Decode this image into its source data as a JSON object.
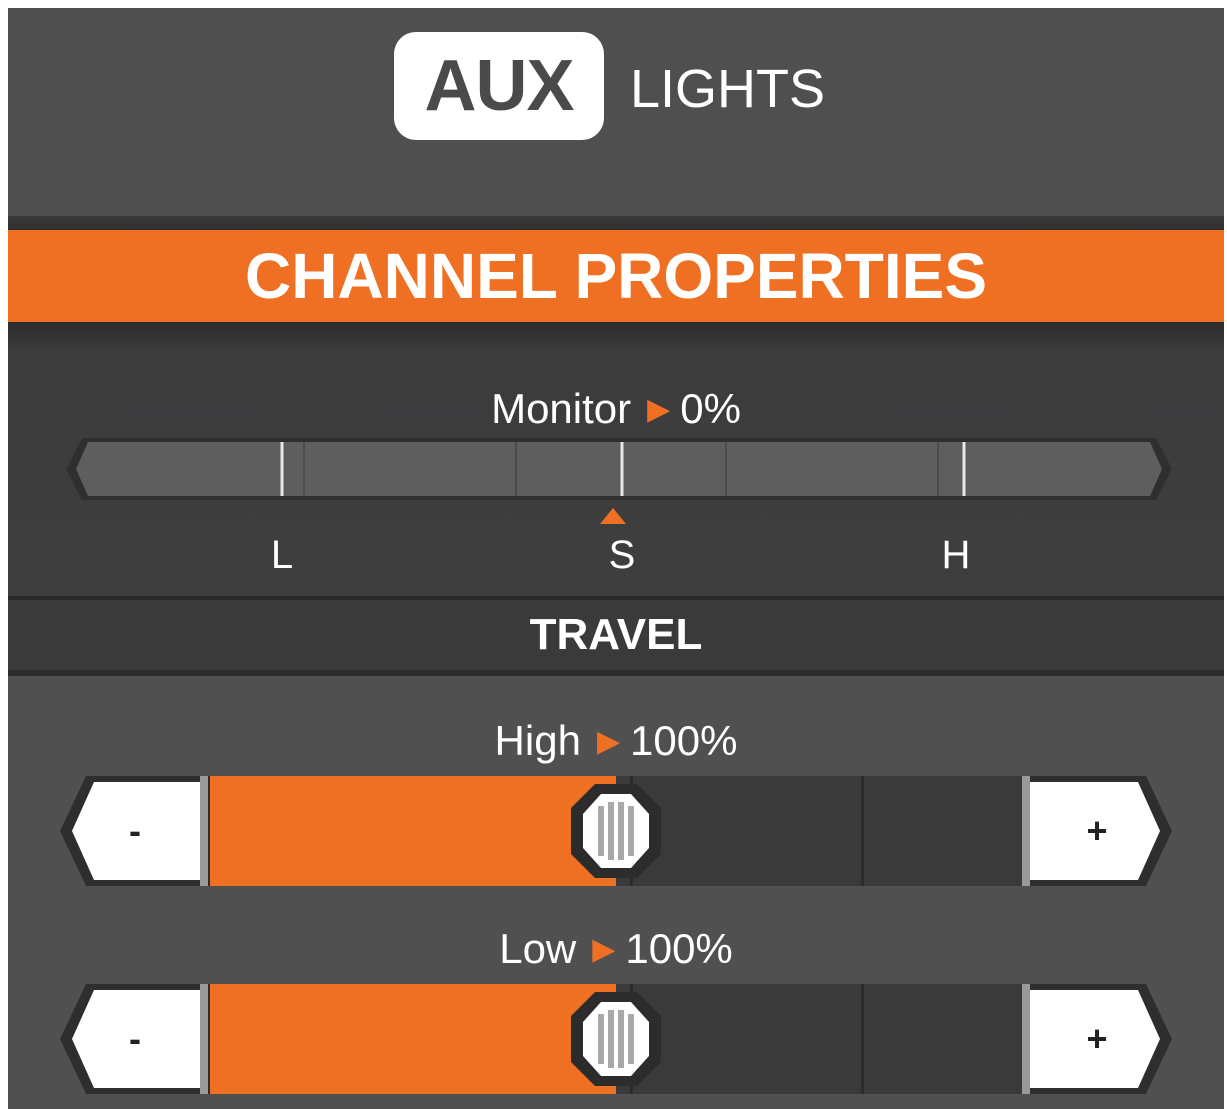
{
  "header": {
    "badge": "AUX",
    "title": "LIGHTS"
  },
  "banner": {
    "title": "CHANNEL PROPERTIES"
  },
  "monitor": {
    "label": "Monitor",
    "value_text": "0%",
    "value": 0,
    "tick_labels": {
      "low": "L",
      "center": "S",
      "high": "H"
    }
  },
  "travel": {
    "title": "TRAVEL",
    "high": {
      "label": "High",
      "value_text": "100%",
      "value": 100,
      "fill_fraction": 0.5,
      "minus": "-",
      "plus": "+"
    },
    "low": {
      "label": "Low",
      "value_text": "100%",
      "value": 100,
      "fill_fraction": 0.5,
      "minus": "-",
      "plus": "+"
    }
  },
  "colors": {
    "accent": "#f07023",
    "background": "#4f4f50",
    "text": "#ffffff"
  },
  "icons": {
    "value_arrow": "right-triangle-icon",
    "monitor_pointer": "up-triangle-icon",
    "slider_thumb": "octagon-grip-icon"
  }
}
